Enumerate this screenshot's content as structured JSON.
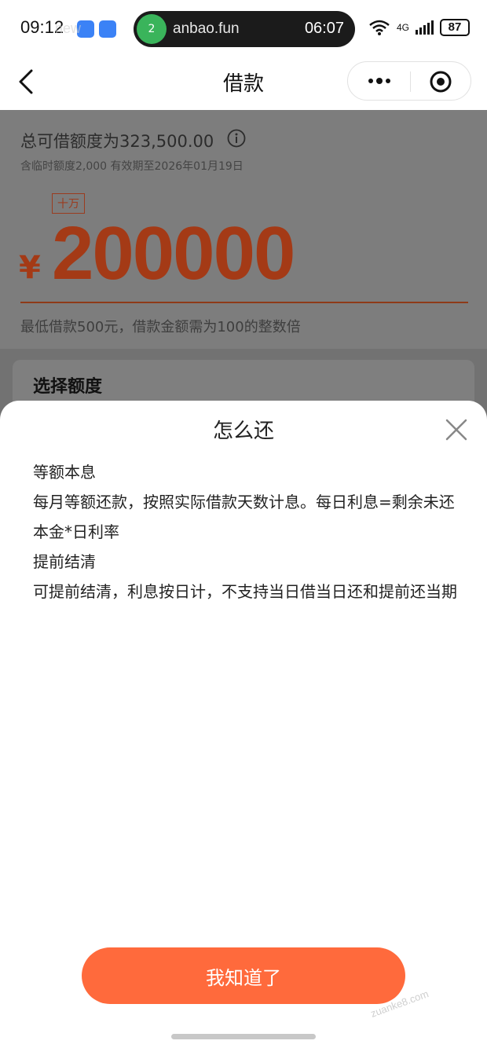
{
  "status": {
    "time": "09:12",
    "call_url": "anbao.fun",
    "call_count": "2",
    "call_time": "06:07",
    "network": "4G",
    "battery": "87"
  },
  "nav": {
    "title": "借款"
  },
  "loan": {
    "total_limit": "总可借额度为323,500.00",
    "temp_limit": "含临时额度2,000 有效期至2026年01月19日",
    "unit_badge": "十万",
    "currency": "¥",
    "amount": "200000",
    "min_hint": "最低借款500元，借款金额需为100的整数倍",
    "section_title": "选择额度"
  },
  "sheet": {
    "title": "怎么还",
    "lines": [
      "等额本息",
      "每月等额还款，按照实际借款天数计息。每日利息=剩余未还本金*日利率",
      "提前结清",
      "可提前结清，利息按日计，不支持当日借当日还和提前还当期"
    ],
    "confirm_label": "我知道了"
  },
  "watermark": {
    "top": "new",
    "bottom": "zuanke8.com"
  }
}
